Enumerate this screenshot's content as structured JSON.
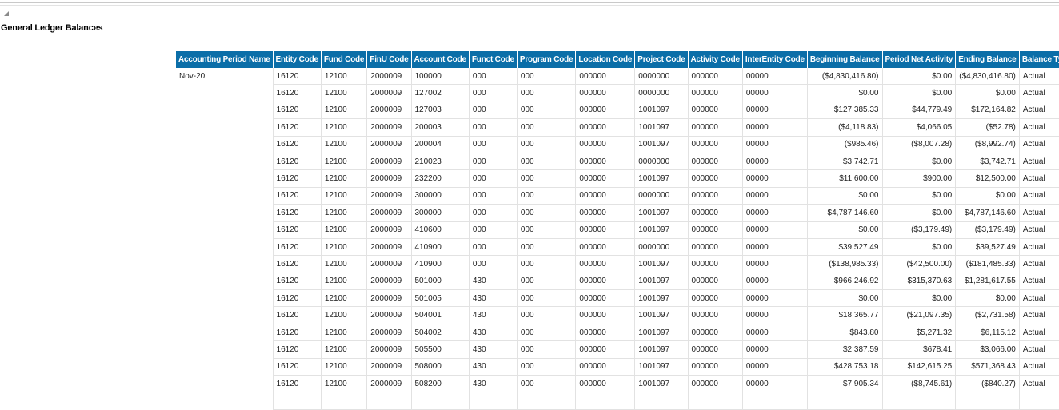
{
  "report": {
    "title": "General Ledger Balances"
  },
  "table": {
    "columns": [
      "Accounting Period Name",
      "Entity Code",
      "Fund Code",
      "FinU Code",
      "Account Code",
      "Funct Code",
      "Program Code",
      "Location Code",
      "Project Code",
      "Activity Code",
      "InterEntity Code",
      "Beginning Balance",
      "Period Net Activity",
      "Ending Balance",
      "Balance Type"
    ],
    "period": "Nov-20",
    "rows": [
      [
        "16120",
        "12100",
        "2000009",
        "100000",
        "000",
        "000",
        "000000",
        "0000000",
        "000000",
        "00000",
        "($4,830,416.80)",
        "$0.00",
        "($4,830,416.80)",
        "Actual"
      ],
      [
        "16120",
        "12100",
        "2000009",
        "127002",
        "000",
        "000",
        "000000",
        "0000000",
        "000000",
        "00000",
        "$0.00",
        "$0.00",
        "$0.00",
        "Actual"
      ],
      [
        "16120",
        "12100",
        "2000009",
        "127003",
        "000",
        "000",
        "000000",
        "1001097",
        "000000",
        "00000",
        "$127,385.33",
        "$44,779.49",
        "$172,164.82",
        "Actual"
      ],
      [
        "16120",
        "12100",
        "2000009",
        "200003",
        "000",
        "000",
        "000000",
        "1001097",
        "000000",
        "00000",
        "($4,118.83)",
        "$4,066.05",
        "($52.78)",
        "Actual"
      ],
      [
        "16120",
        "12100",
        "2000009",
        "200004",
        "000",
        "000",
        "000000",
        "1001097",
        "000000",
        "00000",
        "($985.46)",
        "($8,007.28)",
        "($8,992.74)",
        "Actual"
      ],
      [
        "16120",
        "12100",
        "2000009",
        "210023",
        "000",
        "000",
        "000000",
        "0000000",
        "000000",
        "00000",
        "$3,742.71",
        "$0.00",
        "$3,742.71",
        "Actual"
      ],
      [
        "16120",
        "12100",
        "2000009",
        "232200",
        "000",
        "000",
        "000000",
        "1001097",
        "000000",
        "00000",
        "$11,600.00",
        "$900.00",
        "$12,500.00",
        "Actual"
      ],
      [
        "16120",
        "12100",
        "2000009",
        "300000",
        "000",
        "000",
        "000000",
        "0000000",
        "000000",
        "00000",
        "$0.00",
        "$0.00",
        "$0.00",
        "Actual"
      ],
      [
        "16120",
        "12100",
        "2000009",
        "300000",
        "000",
        "000",
        "000000",
        "1001097",
        "000000",
        "00000",
        "$4,787,146.60",
        "$0.00",
        "$4,787,146.60",
        "Actual"
      ],
      [
        "16120",
        "12100",
        "2000009",
        "410600",
        "000",
        "000",
        "000000",
        "1001097",
        "000000",
        "00000",
        "$0.00",
        "($3,179.49)",
        "($3,179.49)",
        "Actual"
      ],
      [
        "16120",
        "12100",
        "2000009",
        "410900",
        "000",
        "000",
        "000000",
        "0000000",
        "000000",
        "00000",
        "$39,527.49",
        "$0.00",
        "$39,527.49",
        "Actual"
      ],
      [
        "16120",
        "12100",
        "2000009",
        "410900",
        "000",
        "000",
        "000000",
        "1001097",
        "000000",
        "00000",
        "($138,985.33)",
        "($42,500.00)",
        "($181,485.33)",
        "Actual"
      ],
      [
        "16120",
        "12100",
        "2000009",
        "501000",
        "430",
        "000",
        "000000",
        "1001097",
        "000000",
        "00000",
        "$966,246.92",
        "$315,370.63",
        "$1,281,617.55",
        "Actual"
      ],
      [
        "16120",
        "12100",
        "2000009",
        "501005",
        "430",
        "000",
        "000000",
        "1001097",
        "000000",
        "00000",
        "$0.00",
        "$0.00",
        "$0.00",
        "Actual"
      ],
      [
        "16120",
        "12100",
        "2000009",
        "504001",
        "430",
        "000",
        "000000",
        "1001097",
        "000000",
        "00000",
        "$18,365.77",
        "($21,097.35)",
        "($2,731.58)",
        "Actual"
      ],
      [
        "16120",
        "12100",
        "2000009",
        "504002",
        "430",
        "000",
        "000000",
        "1001097",
        "000000",
        "00000",
        "$843.80",
        "$5,271.32",
        "$6,115.12",
        "Actual"
      ],
      [
        "16120",
        "12100",
        "2000009",
        "505500",
        "430",
        "000",
        "000000",
        "1001097",
        "000000",
        "00000",
        "$2,387.59",
        "$678.41",
        "$3,066.00",
        "Actual"
      ],
      [
        "16120",
        "12100",
        "2000009",
        "508000",
        "430",
        "000",
        "000000",
        "1001097",
        "000000",
        "00000",
        "$428,753.18",
        "$142,615.25",
        "$571,368.43",
        "Actual"
      ],
      [
        "16120",
        "12100",
        "2000009",
        "508200",
        "430",
        "000",
        "000000",
        "1001097",
        "000000",
        "00000",
        "$7,905.34",
        "($8,745.61)",
        "($840.27)",
        "Actual"
      ],
      [
        "",
        "",
        "",
        "",
        "",
        "",
        "",
        "",
        "",
        "",
        "",
        "",
        "",
        ""
      ]
    ]
  }
}
